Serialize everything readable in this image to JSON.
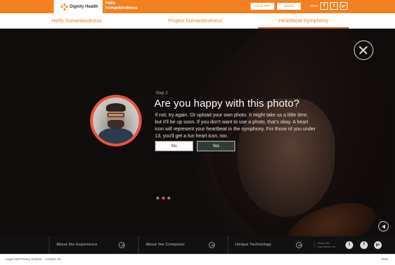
{
  "header": {
    "brand_name": "Dignity Health",
    "campaign_title": "Hello humankindness",
    "about_button": "About HHK",
    "search_button": "Search",
    "share_label": "Share",
    "share_icons": [
      "facebook-icon",
      "twitter-icon",
      "google-plus-icon"
    ]
  },
  "nav": {
    "tabs": [
      {
        "label": "Hello humankindness"
      },
      {
        "label": "Project humankindness"
      },
      {
        "label": "Heartbeat Symphony",
        "active": true
      }
    ]
  },
  "modal": {
    "step": "Step 2",
    "question": "Are you happy with this photo?",
    "description": "If not, try again. Or upload your own photo. It might take us a little time, but it'll be up soon. If you don't want to use a photo, that's okay. A heart icon will represent your heartbeat in the symphony. For those of you under 13, you'll get a fun heart icon, too.",
    "no_label": "No",
    "yes_label": "Yes"
  },
  "carousel": {
    "count": 3,
    "active_index": 1
  },
  "footer": {
    "items": [
      {
        "label": "About the Experience"
      },
      {
        "label": "About the Composer"
      },
      {
        "label": "Unique Technology"
      }
    ],
    "share_text": "Share the experience on:",
    "social_icons": [
      "twitter-icon",
      "facebook-icon",
      "google-plus-icon"
    ]
  },
  "bottom": {
    "legal": "Legal and Privacy Notices",
    "contact": "Contact Us",
    "year": "2015"
  },
  "colors": {
    "accent": "#f4801f",
    "ring": "#e8553d",
    "yes_button": "#2f3c37"
  }
}
